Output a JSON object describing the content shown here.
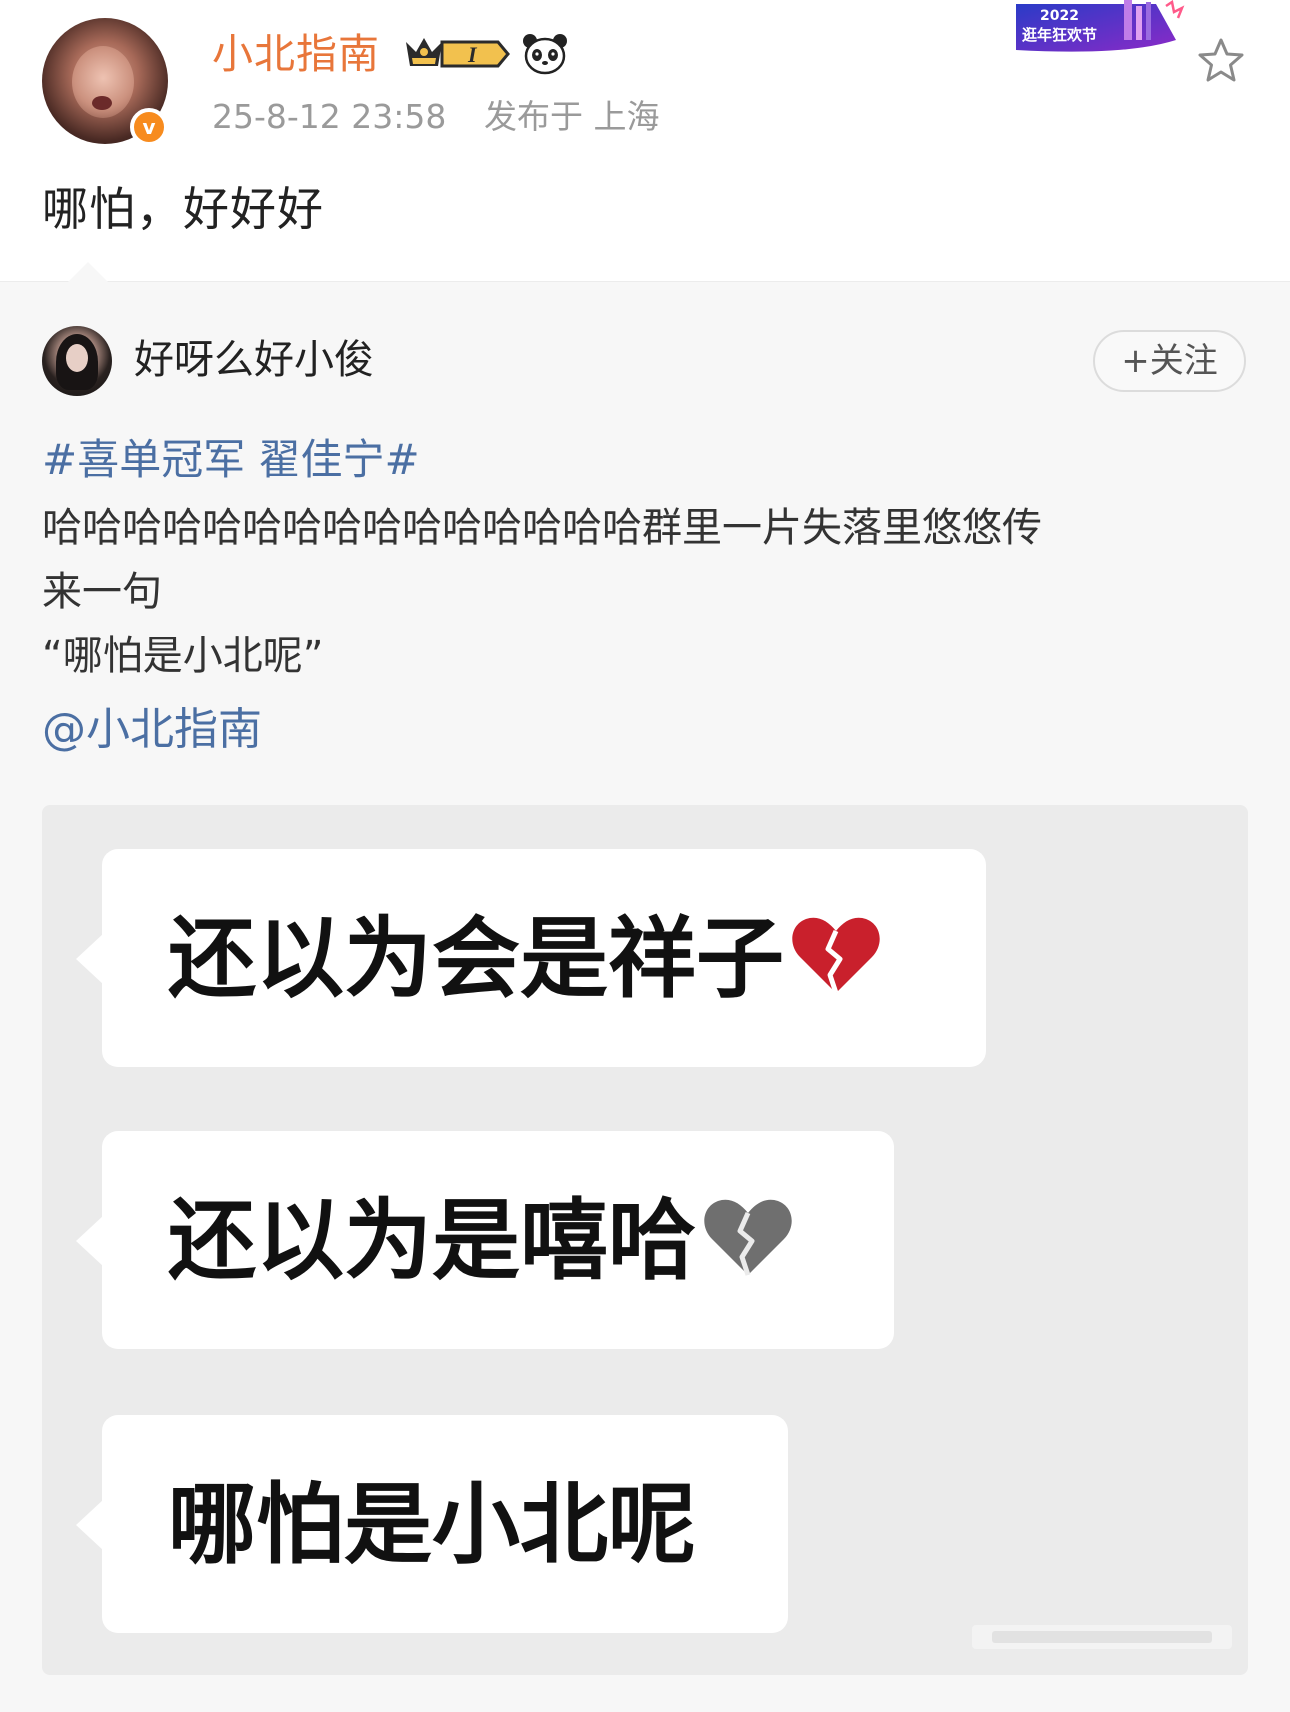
{
  "post": {
    "username": "小北指南",
    "timestamp": "25-8-12 23:58",
    "location": "发布于 上海",
    "text": "哪怕，好好好",
    "level_badge": "I",
    "event_banner": {
      "year": "2022",
      "name": "逛年狂欢节"
    },
    "colors": {
      "username": "#e8763a",
      "verified": "#f78b1e"
    }
  },
  "repost": {
    "username": "好呀么好小俊",
    "follow_label": "+关注",
    "hashtag": "#喜单冠军 翟佳宁#",
    "body_line1": "哈哈哈哈哈哈哈哈哈哈哈哈哈哈哈群里一片失落里悠悠传",
    "body_line2": "来一句",
    "body_line3": "“哪怕是小北呢”",
    "mention": "@小北指南",
    "colors": {
      "link": "#4b6fa3"
    }
  },
  "chat_image": {
    "messages": [
      {
        "text": "还以为会是祥子",
        "icon": "broken-heart-red-icon"
      },
      {
        "text": "还以为是嘻哈",
        "icon": "broken-heart-grey-icon"
      },
      {
        "text": "哪怕是小北呢"
      }
    ]
  }
}
